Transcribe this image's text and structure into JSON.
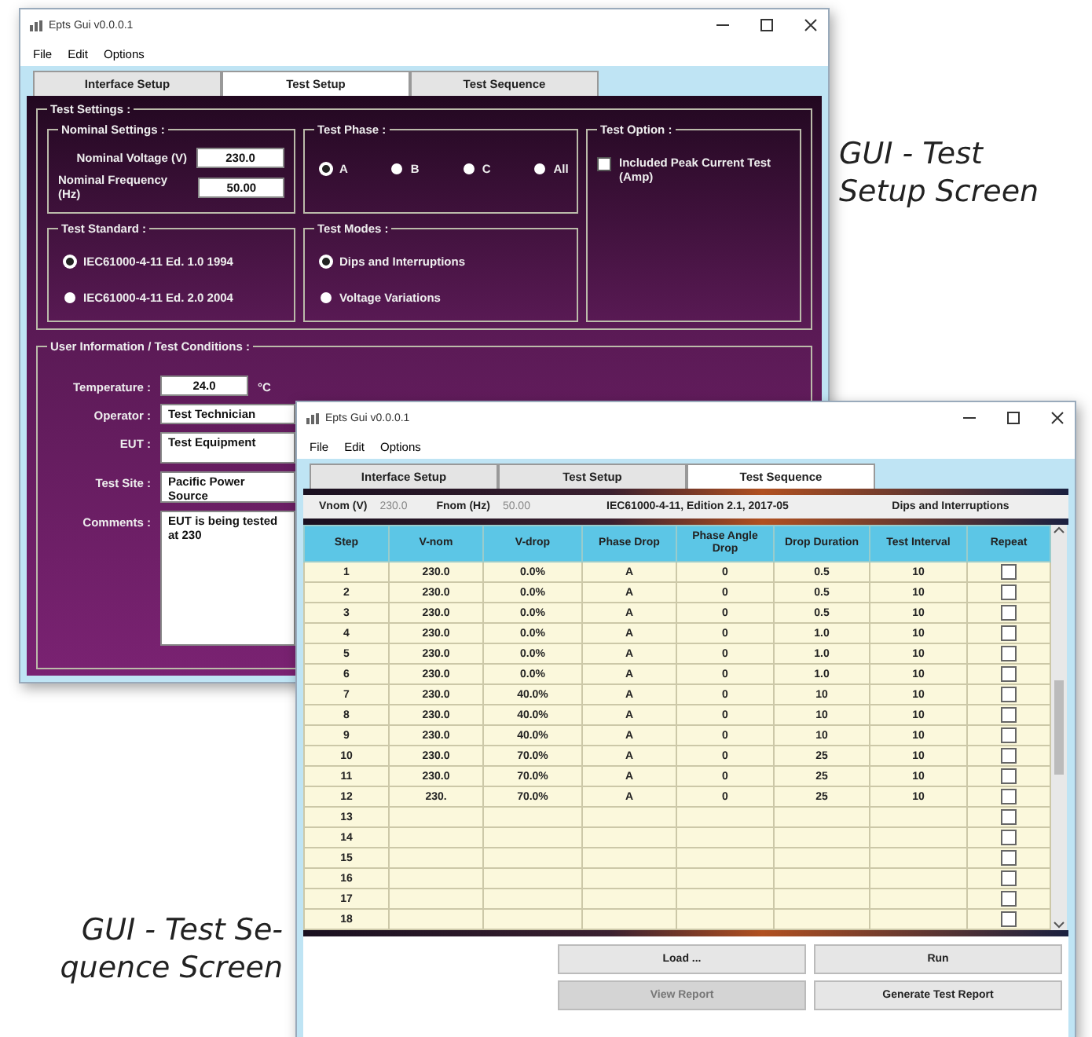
{
  "setup_caption": {
    "lines": [
      "GUI - Test",
      "Setup Screen"
    ]
  },
  "sequence_caption": {
    "lines": [
      "GUI - Test Se-",
      "quence Screen"
    ]
  },
  "setup_window": {
    "title": "Epts Gui v0.0.0.1",
    "menu": [
      "File",
      "Edit",
      "Options"
    ],
    "tabs": [
      {
        "label": "Interface Setup",
        "selected": false
      },
      {
        "label": "Test Setup",
        "selected": true
      },
      {
        "label": "Test Sequence",
        "selected": false
      }
    ],
    "test_settings": {
      "title": "Test Settings :",
      "nominal": {
        "title": "Nominal Settings :",
        "fields": [
          {
            "label": "Nominal Voltage (V)",
            "value": "230.0"
          },
          {
            "label": "Nominal Frequency (Hz)",
            "value": "50.00"
          }
        ]
      },
      "phase": {
        "title": "Test Phase :",
        "options": [
          {
            "label": "A",
            "selected": true
          },
          {
            "label": "B",
            "selected": false
          },
          {
            "label": "C",
            "selected": false
          },
          {
            "label": "All",
            "selected": false
          }
        ]
      },
      "option": {
        "title": "Test Option :",
        "checkboxes": [
          {
            "label": "Included Peak Current Test (Amp)",
            "checked": false
          }
        ]
      },
      "standard": {
        "title": "Test Standard :",
        "options": [
          {
            "label": "IEC61000-4-11 Ed. 1.0 1994",
            "selected": true
          },
          {
            "label": "IEC61000-4-11 Ed. 2.0 2004",
            "selected": false
          }
        ]
      },
      "modes": {
        "title": "Test Modes :",
        "options": [
          {
            "label": "Dips and Interruptions",
            "selected": true
          },
          {
            "label": "Voltage Variations",
            "selected": false
          }
        ]
      }
    },
    "user_info": {
      "title": "User Information / Test Conditions :",
      "fields": [
        {
          "kind": "short",
          "label": "Temperature :",
          "value": "24.0",
          "unit": "°C"
        },
        {
          "kind": "line",
          "label": "Operator :",
          "value": "Test Technician"
        },
        {
          "kind": "double",
          "label": "EUT :",
          "value": "Test Equipment"
        },
        {
          "kind": "double",
          "label": "Test Site :",
          "value": "Pacific Power Source"
        },
        {
          "kind": "multi",
          "label": "Comments :",
          "value": "EUT is being tested at 230"
        }
      ]
    }
  },
  "sequence_window": {
    "title": "Epts Gui v0.0.0.1",
    "menu": [
      "File",
      "Edit",
      "Options"
    ],
    "tabs": [
      {
        "label": "Interface Setup",
        "selected": false
      },
      {
        "label": "Test Setup",
        "selected": false
      },
      {
        "label": "Test Sequence",
        "selected": true
      }
    ],
    "info": {
      "vnom_label": "Vnom (V)",
      "vnom_value": "230.0",
      "fnom_label": "Fnom (Hz)",
      "fnom_value": "50.00",
      "standard": "IEC61000-4-11, Edition 2.1, 2017-05",
      "mode": "Dips and Interruptions"
    },
    "table": {
      "columns": [
        "Step",
        "V-nom",
        "V-drop",
        "Phase Drop",
        "Phase Angle Drop",
        "Drop Duration",
        "Test Interval",
        "Repeat"
      ],
      "rows": [
        {
          "cells": [
            "1",
            "230.0",
            "0.0%",
            "A",
            "0",
            "0.5",
            "10"
          ],
          "repeat": false
        },
        {
          "cells": [
            "2",
            "230.0",
            "0.0%",
            "A",
            "0",
            "0.5",
            "10"
          ],
          "repeat": false
        },
        {
          "cells": [
            "3",
            "230.0",
            "0.0%",
            "A",
            "0",
            "0.5",
            "10"
          ],
          "repeat": false
        },
        {
          "cells": [
            "4",
            "230.0",
            "0.0%",
            "A",
            "0",
            "1.0",
            "10"
          ],
          "repeat": false
        },
        {
          "cells": [
            "5",
            "230.0",
            "0.0%",
            "A",
            "0",
            "1.0",
            "10"
          ],
          "repeat": false
        },
        {
          "cells": [
            "6",
            "230.0",
            "0.0%",
            "A",
            "0",
            "1.0",
            "10"
          ],
          "repeat": false
        },
        {
          "cells": [
            "7",
            "230.0",
            "40.0%",
            "A",
            "0",
            "10",
            "10"
          ],
          "repeat": false
        },
        {
          "cells": [
            "8",
            "230.0",
            "40.0%",
            "A",
            "0",
            "10",
            "10"
          ],
          "repeat": false
        },
        {
          "cells": [
            "9",
            "230.0",
            "40.0%",
            "A",
            "0",
            "10",
            "10"
          ],
          "repeat": false
        },
        {
          "cells": [
            "10",
            "230.0",
            "70.0%",
            "A",
            "0",
            "25",
            "10"
          ],
          "repeat": false
        },
        {
          "cells": [
            "11",
            "230.0",
            "70.0%",
            "A",
            "0",
            "25",
            "10"
          ],
          "repeat": false
        },
        {
          "cells": [
            "12",
            "230.",
            "70.0%",
            "A",
            "0",
            "25",
            "10"
          ],
          "repeat": false
        },
        {
          "cells": [
            "13"
          ],
          "repeat": false
        },
        {
          "cells": [
            "14"
          ],
          "repeat": false
        },
        {
          "cells": [
            "15"
          ],
          "repeat": false
        },
        {
          "cells": [
            "16"
          ],
          "repeat": false
        },
        {
          "cells": [
            "17"
          ],
          "repeat": false
        },
        {
          "cells": [
            "18"
          ],
          "repeat": false
        }
      ]
    },
    "buttons": [
      {
        "label": "Load ...",
        "disabled": false
      },
      {
        "label": "Run",
        "disabled": false
      },
      {
        "label": "View Report",
        "disabled": true
      },
      {
        "label": "Generate Test Report",
        "disabled": false
      }
    ]
  }
}
